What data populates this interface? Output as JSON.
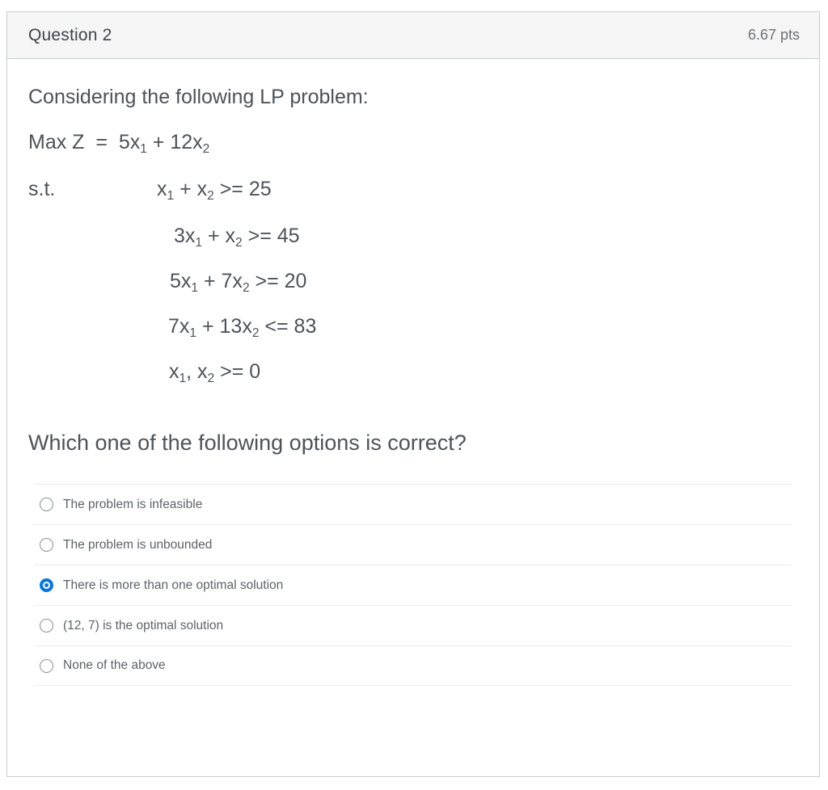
{
  "header": {
    "title": "Question 2",
    "points": "6.67 pts"
  },
  "body": {
    "prompt": "Considering the following LP problem:",
    "objective": {
      "prefix": "Max Z  =  5x",
      "sub1": "1",
      "mid": " + 12x",
      "sub2": "2"
    },
    "st_label": "s.t.",
    "constraints": [
      {
        "a": "x",
        "s1": "1",
        "b": " + x",
        "s2": "2",
        "c": " >= 25"
      },
      {
        "a": "3x",
        "s1": "1",
        "b": " + x",
        "s2": "2",
        "c": " >= 45"
      },
      {
        "a": "5x",
        "s1": "1",
        "b": " + 7x",
        "s2": "2",
        "c": " >= 20"
      },
      {
        "a": "7x",
        "s1": "1",
        "b": " + 13x",
        "s2": "2",
        "c": " <= 83"
      },
      {
        "a": "x",
        "s1": "1",
        "b": ", x",
        "s2": "2",
        "c": " >= 0"
      }
    ],
    "sub_question": "Which one of the following options is correct?"
  },
  "answers": {
    "options": [
      {
        "label": "The problem is infeasible",
        "selected": false
      },
      {
        "label": "The problem is unbounded",
        "selected": false
      },
      {
        "label": "There is more than one optimal solution",
        "selected": true
      },
      {
        "label": "(12, 7) is the optimal solution",
        "selected": false
      },
      {
        "label": "None of the above",
        "selected": false
      }
    ]
  },
  "colors": {
    "accent": "#0b76d8",
    "text": "#4d5359",
    "muted": "#5e6366",
    "border": "#c7cdd1",
    "header_bg": "#f5f5f5"
  }
}
